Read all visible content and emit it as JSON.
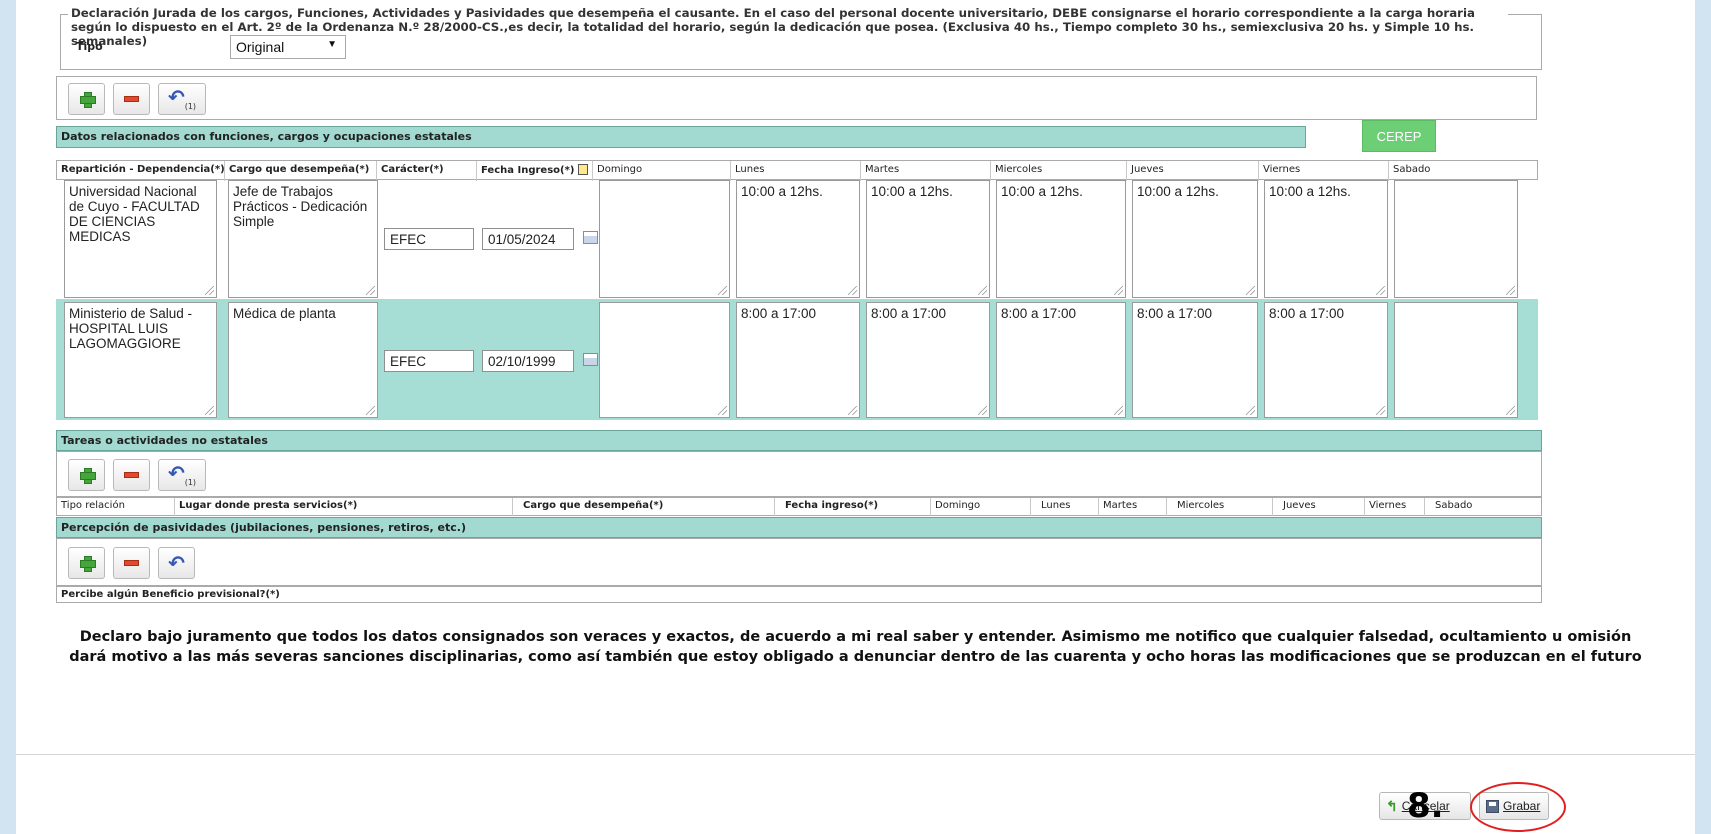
{
  "header": {
    "legend": "Declaración Jurada de los cargos, Funciones, Actividades y Pasividades que desempeña el causante. En el caso del personal docente universitario, DEBE consignarse el horario correspondiente a la carga horaria según lo dispuesto en el Art. 2º de la Ordenanza N.º 28/2000-CS.,es decir, la totalidad del horario, según la dedicación que posea. (Exclusiva 40 hs., Tiempo completo 30 hs., semiexclusiva 20 hs. y Simple 10 hs. semanales)",
    "tipo_label": "Tipo",
    "tipo_value": "Original"
  },
  "toolbar": {
    "undo_count": "(1)"
  },
  "estatales": {
    "title": "Datos relacionados con funciones, cargos y ocupaciones estatales",
    "cerep_label": "CEREP",
    "columns": [
      "Repartición - Dependencia(*)",
      "Cargo que desempeña(*)",
      "Carácter(*)",
      "Fecha Ingreso(*)",
      "Domingo",
      "Lunes",
      "Martes",
      "Miercoles",
      "Jueves",
      "Viernes",
      "Sabado"
    ],
    "rows": [
      {
        "reparticion": "Universidad Nacional de Cuyo - FACULTAD DE CIENCIAS MEDICAS",
        "cargo": "Jefe de Trabajos Prácticos - Dedicación Simple",
        "caracter": "EFEC",
        "fecha": "01/05/2024",
        "domingo": "",
        "lunes": "10:00 a 12hs.",
        "martes": "10:00 a 12hs.",
        "miercoles": "10:00 a 12hs.",
        "jueves": "10:00 a 12hs.",
        "viernes": "10:00 a 12hs.",
        "sabado": ""
      },
      {
        "reparticion": "Ministerio de Salud - HOSPITAL LUIS LAGOMAGGIORE",
        "cargo": "Médica de planta",
        "caracter": "EFEC",
        "fecha": "02/10/1999",
        "domingo": "",
        "lunes": "8:00 a 17:00",
        "martes": "8:00 a 17:00",
        "miercoles": "8:00 a 17:00",
        "jueves": "8:00 a 17:00",
        "viernes": "8:00 a 17:00",
        "sabado": ""
      }
    ]
  },
  "no_estatales": {
    "title": "Tareas o actividades no estatales",
    "undo_count": "(1)",
    "columns": [
      "Tipo relación",
      "Lugar donde presta servicios(*)",
      "Cargo que desempeña(*)",
      "Fecha ingreso(*)",
      "Domingo",
      "Lunes",
      "Martes",
      "Miercoles",
      "Jueves",
      "Viernes",
      "Sabado"
    ]
  },
  "pasividades": {
    "title": "Percepción de pasividades (jubilaciones, pensiones, retiros, etc.)",
    "column": "Percibe algún Beneficio previsional?(*)"
  },
  "declaracion": {
    "line1": "Declaro bajo juramento que todos los datos consignados son veraces y exactos, de acuerdo a mi real saber y entender. Asimismo me notifico que cualquier falsedad, ocultamiento u omisión",
    "line2": "dará motivo a las más severas sanciones disciplinarias, como así también que estoy obligado a denunciar dentro de las cuarenta y ocho horas las modificaciones que se produzcan en el futuro"
  },
  "footer": {
    "cancel_label": "Cancelar",
    "save_label": "Grabar",
    "step_annotation": "8."
  },
  "colors": {
    "section_bar": "#a2d9d0",
    "cerep": "#6ccf76",
    "annotation_circle": "#e02020"
  }
}
